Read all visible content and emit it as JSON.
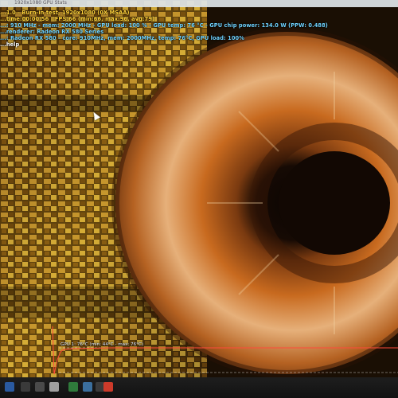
{
  "colors": {
    "title_yellow": "#ffd23a",
    "info_blue": "#6fd3ff",
    "gpu_text": "#e6ecff",
    "iris_orange": "#d97a1e",
    "pupil": "#120803"
  },
  "window": {
    "title_fragment": "1920x1080 GPU Stats"
  },
  "overlay_lines": [
    "...1.0 - Burn-in test, 1920x1080 (0X MSAA)",
    "...time:00:00:56 - FPS:66 (min:66, max:96, avg:79)",
    "...: 910 MHz - mem: 2000 MHz - GPU load: 100 % - GPU temp: 76 °C - GPU chip power: 134.0 W (PPW: 0.488)",
    "...renderer: Radeon RX 580 Series",
    "...: Radeon RX 580 - core: 910MHz, mem: 2000MHz, temp: 76°C, GPU load: 100%",
    "...help"
  ],
  "graph": {
    "label": "GPU 1: 76°C (min: 44°C - max: 76°C)"
  },
  "taskbar": {
    "icons": [
      "windows-icon",
      "search-icon",
      "task-view-icon",
      "file-explorer-icon",
      "app-icon-1",
      "app-icon-2",
      "app-icon-3",
      "furmark-icon"
    ]
  }
}
